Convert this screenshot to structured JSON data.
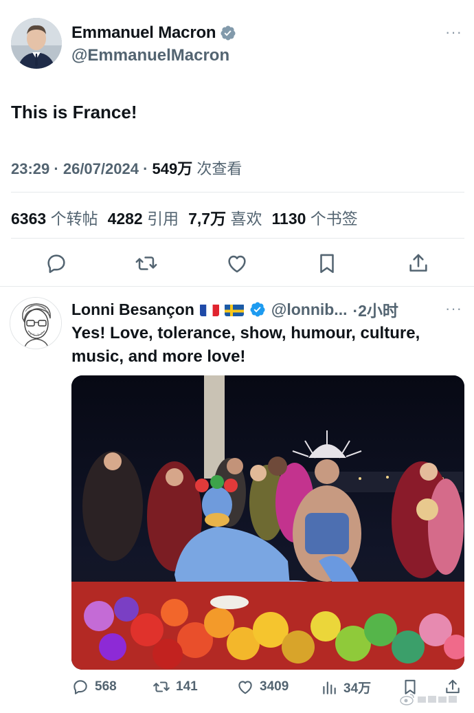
{
  "main_tweet": {
    "author_name": "Emmanuel Macron",
    "handle": "@EmmanuelMacron",
    "more": "···",
    "text": "This is France!",
    "time": "23:29",
    "date": "26/07/2024",
    "views_count": "549万",
    "views_label": "次查看",
    "stats": {
      "reposts_count": "6363",
      "reposts_label": "个转帖",
      "quotes_count": "4282",
      "quotes_label": "引用",
      "likes_count": "7,7万",
      "likes_label": "喜欢",
      "bookmarks_count": "1130",
      "bookmarks_label": "个书签"
    }
  },
  "reply_tweet": {
    "author_name": "Lonni Besançon",
    "handle": "@lonnib...",
    "time": "·2小时",
    "more": "···",
    "text": "Yes! Love, tolerance, show, humour, culture, music, and more love!",
    "actions": {
      "replies": "568",
      "reposts": "141",
      "likes": "3409",
      "views": "34万"
    }
  },
  "colors": {
    "verified": "#1d9bf0",
    "secondary_text": "#536471",
    "primary_text": "#0f1419"
  },
  "icons": [
    "verified-badge-icon",
    "reply-icon",
    "repost-icon",
    "like-icon",
    "bookmark-icon",
    "share-icon",
    "views-icon"
  ]
}
